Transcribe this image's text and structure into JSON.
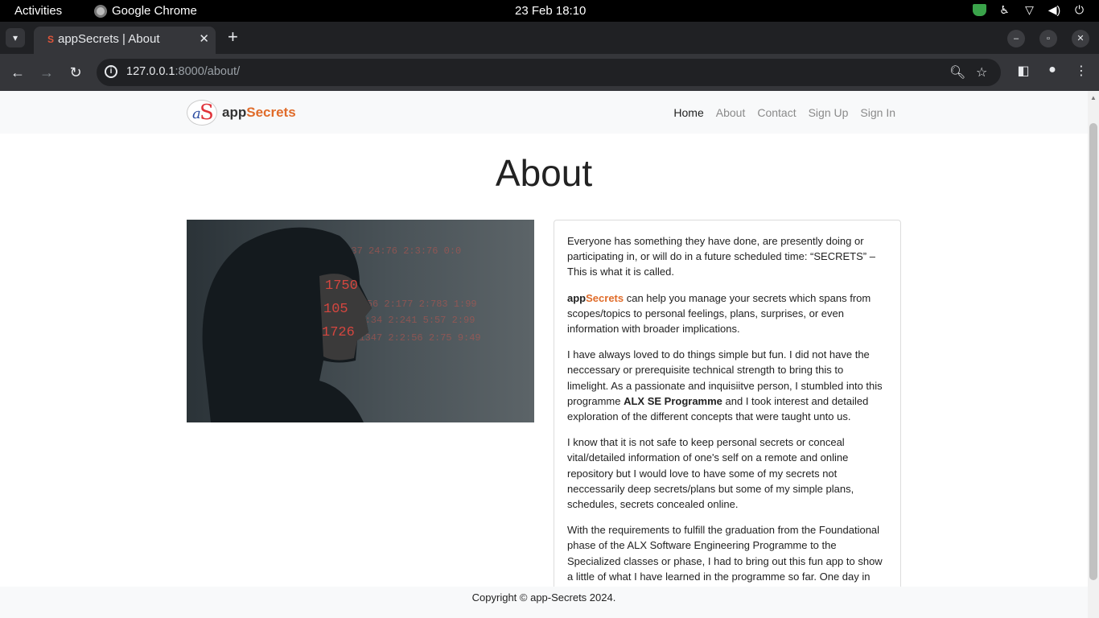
{
  "system": {
    "activities": "Activities",
    "app_name": "Google Chrome",
    "clock": "23 Feb  18:10"
  },
  "browser": {
    "tab_title": "appSecrets | About",
    "tab_favicon": "S",
    "url_host": "127.0.0.1",
    "url_rest": ":8000/about/"
  },
  "site": {
    "brand_prefix": "app",
    "brand_accent": "Secrets",
    "logo_a": "a",
    "logo_s": "S",
    "nav": [
      "Home",
      "About",
      "Contact",
      "Sign Up",
      "Sign In"
    ],
    "active_nav": "Home",
    "accent_color": "#e06c2a"
  },
  "main": {
    "title": "About",
    "p1": "Everyone has something they have done, are presently doing or participating in, or will do in a future scheduled time: “SECRETS” – This is what it is called.",
    "p2_brand_prefix": "app",
    "p2_brand_accent": "Secrets",
    "p2_rest": " can help you manage your secrets which spans from scopes/topics to personal feelings, plans, surprises, or even information with broader implications.",
    "p3_start": "I have always loved to do things simple but fun. I did not have the neccessary or prerequisite technical strength to bring this to limelight. As a passionate and inquisiitve person, I stumbled into this programme ",
    "p3_bold": "ALX SE Programme",
    "p3_end": " and I took interest and detailed exploration of the different concepts that were taught unto us.",
    "p4": "I know that it is not safe to keep personal secrets or conceal vital/detailed information of one's self on a remote and online repository but I would love to have some of my secrets not neccessarily deep secrets/plans but some of my simple plans, schedules, secrets concealed online.",
    "p5": "With the requirements to fulfill the graduation from the Foundational phase of the ALX Software Engineering Programme to the Specialized classes or phase, I had to bring out this fun app to show a little of what I have learned in the programme so far. One day in the"
  },
  "hero": {
    "numbers": [
      "1750",
      "105",
      "1726",
      "2:37 24:76 2:3:76 0:0",
      "2:2:56 2:177 2:783 1:99",
      "3:4:34 2:241 5:57 2:99",
      "2:1347 2:2:56 2:75 9:49"
    ]
  },
  "footer": {
    "text": "Copyright © app-Secrets 2024."
  }
}
